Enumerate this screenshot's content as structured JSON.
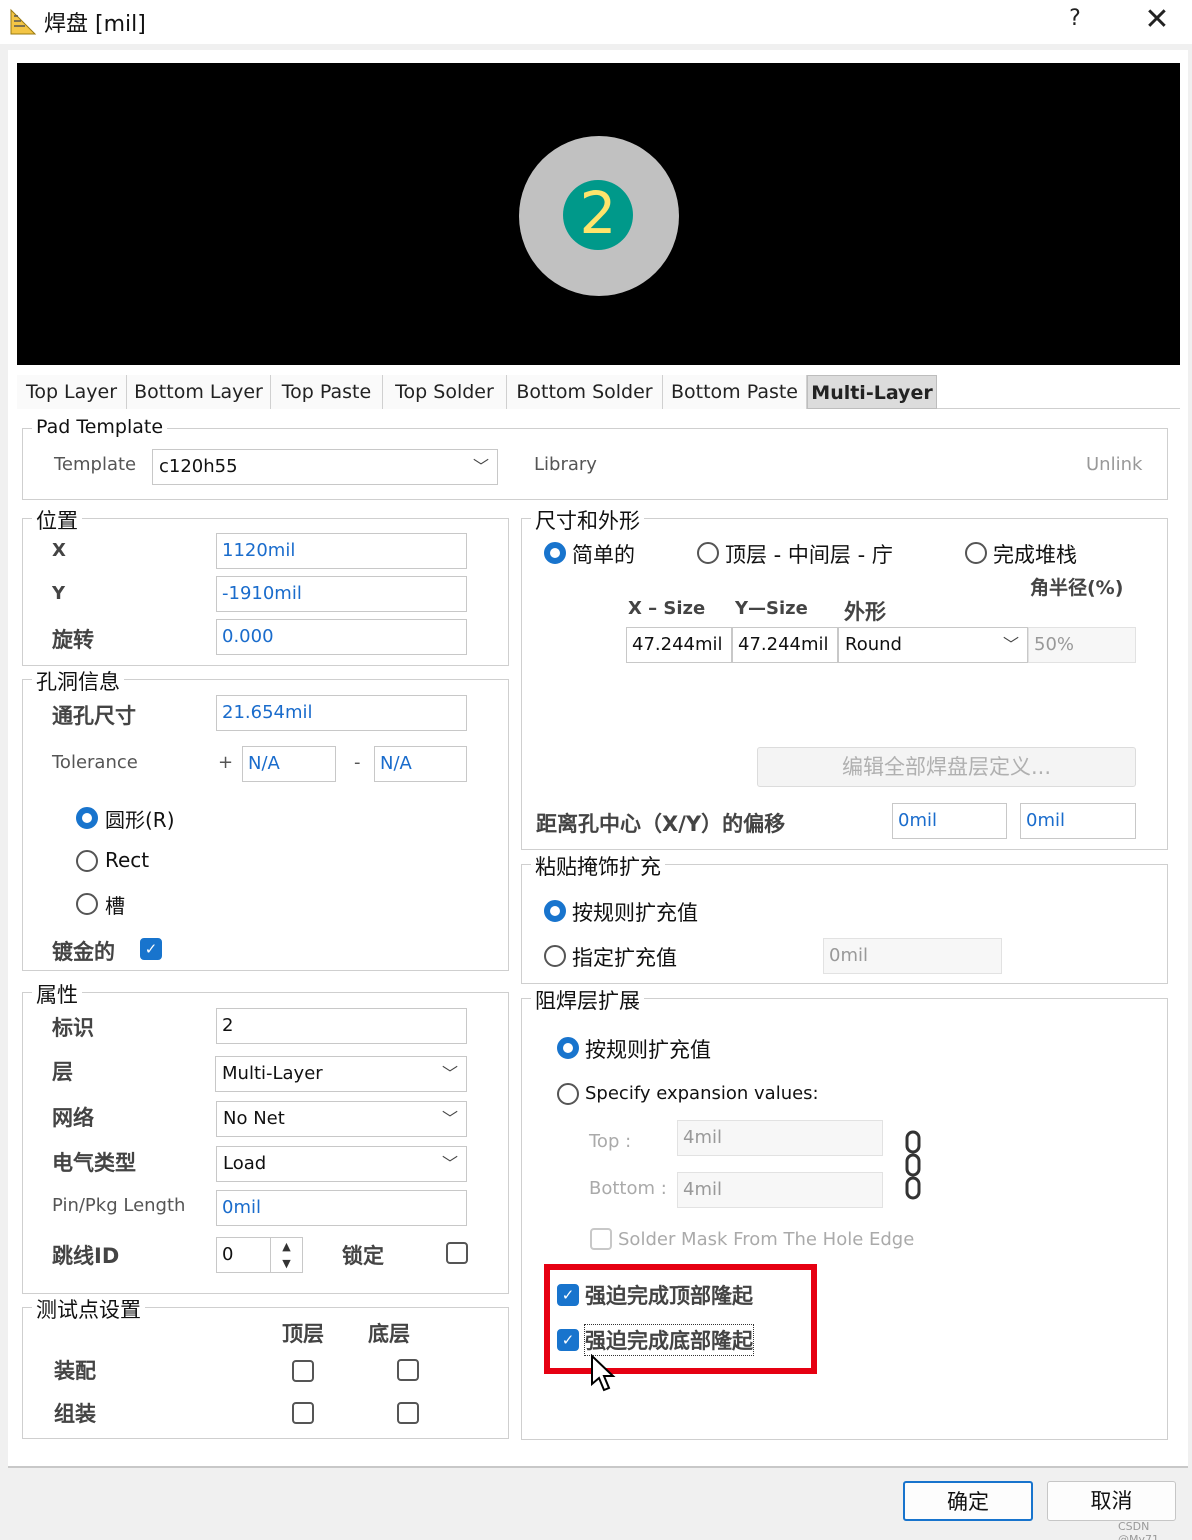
{
  "window": {
    "title": "焊盘 [mil]",
    "help": "?",
    "close": "✕"
  },
  "preview": {
    "pad_number": "2",
    "colors": {
      "background": "#000000",
      "pad": "#c1c1c1",
      "hole": "#00998a",
      "number": "#ffe46b"
    }
  },
  "tabs": [
    "Top Layer",
    "Bottom Layer",
    "Top Paste",
    "Top Solder",
    "Bottom Solder",
    "Bottom Paste",
    "Multi-Layer"
  ],
  "active_tab": "Multi-Layer",
  "pad_template": {
    "group_label": "Pad Template",
    "template_label": "Template",
    "template_value": "c120h55",
    "library_label": "Library",
    "unlink_label": "Unlink"
  },
  "position": {
    "group_label": "位置",
    "x_label": "X",
    "x_value": "1120mil",
    "y_label": "Y",
    "y_value": "-1910mil",
    "rotation_label": "旋转",
    "rotation_value": "0.000"
  },
  "hole": {
    "group_label": "孔洞信息",
    "size_label": "通孔尺寸",
    "size_value": "21.654mil",
    "tolerance_label": "Tolerance",
    "plus": "+",
    "plus_value": "N/A",
    "minus": "-",
    "minus_value": "N/A",
    "round_label": "圆形(R)",
    "rect_label": "Rect",
    "slot_label": "槽",
    "plated_label": "镀金的"
  },
  "properties": {
    "group_label": "属性",
    "designator_label": "标识",
    "designator_value": "2",
    "layer_label": "层",
    "layer_value": "Multi-Layer",
    "net_label": "网络",
    "net_value": "No Net",
    "electrical_label": "电气类型",
    "electrical_value": "Load",
    "pinpkg_label": "Pin/Pkg Length",
    "pinpkg_value": "0mil",
    "jumper_label": "跳线ID",
    "jumper_value": "0",
    "lock_label": "锁定"
  },
  "testpoint": {
    "group_label": "测试点设置",
    "top_label": "顶层",
    "bottom_label": "底层",
    "fab_label": "装配",
    "assy_label": "组装"
  },
  "size_shape": {
    "group_label": "尺寸和外形",
    "simple_label": "简单的",
    "topmid_label": "顶层 - 中间层 - 庁",
    "fullstack_label": "完成堆栈",
    "corner_label": "角半径(%)",
    "xsize_label": "X – Size",
    "ysize_label": "Y—Size",
    "shape_label": "外形",
    "xsize_value": "47.244mil",
    "ysize_value": "47.244mil",
    "shape_value": "Round",
    "corner_value": "50%",
    "edit_all_label": "编辑全部焊盘层定义...",
    "offset_label": "距离孔中心（X/Y）的偏移",
    "offset_x": "0mil",
    "offset_y": "0mil"
  },
  "paste": {
    "group_label": "粘贴掩饰扩充",
    "rule_label": "按规则扩充值",
    "specify_label": "指定扩充值",
    "specify_value": "0mil"
  },
  "solder": {
    "group_label": "阻焊层扩展",
    "rule_label": "按规则扩充值",
    "specify_label": "Specify expansion values:",
    "top_label": "Top :",
    "top_value": "4mil",
    "bottom_label": "Bottom :",
    "bottom_value": "4mil",
    "hole_edge_label": "Solder Mask From The Hole Edge",
    "force_top_label": "强迫完成顶部隆起",
    "force_bottom_label": "强迫完成底部隆起"
  },
  "buttons": {
    "ok": "确定",
    "cancel": "取消"
  },
  "watermark": "CSDN @My71",
  "accent_color": "#1874cd",
  "highlight_color": "#e60012"
}
